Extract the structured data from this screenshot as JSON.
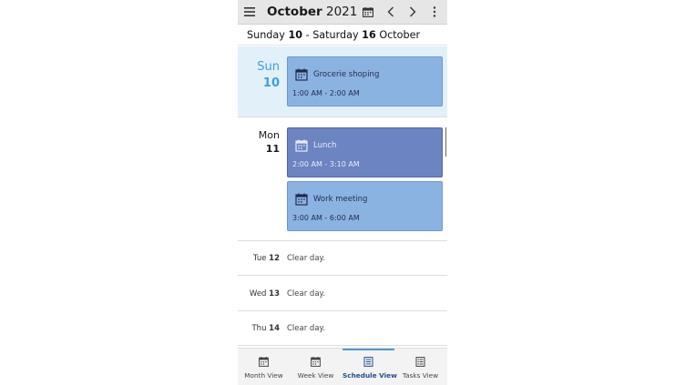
{
  "header": {
    "title_bold": "October",
    "title_year": "2021",
    "icons": [
      "menu-icon",
      "calendar-icon",
      "chevron-left-icon",
      "chevron-right-icon",
      "more-vertical-icon"
    ]
  },
  "range": {
    "start_day": "Sunday",
    "start_num": "10",
    "separator": "-",
    "end_day": "Saturday",
    "end_num": "16",
    "month": "October"
  },
  "days": [
    {
      "name": "Sun",
      "num": "10",
      "events": [
        {
          "title": "Grocerie shoping",
          "time": "1:00 AM - 2:00 AM"
        }
      ]
    },
    {
      "name": "Mon",
      "num": "11",
      "events": [
        {
          "title": "Lunch",
          "time": "2:00 AM - 3:10 AM"
        },
        {
          "title": "Work meeting",
          "time": "3:00 AM - 6:00 AM"
        }
      ]
    }
  ],
  "clear_days": [
    {
      "name": "Tue",
      "num": "12",
      "text": "Clear day."
    },
    {
      "name": "Wed",
      "num": "13",
      "text": "Clear day."
    },
    {
      "name": "Thu",
      "num": "14",
      "text": "Clear day."
    }
  ],
  "nav": [
    {
      "label": "Month View",
      "icon": "calendar-icon",
      "active": false
    },
    {
      "label": "Week View",
      "icon": "calendar-icon",
      "active": false
    },
    {
      "label": "Schedule View",
      "icon": "list-icon",
      "active": true
    },
    {
      "label": "Tasks View",
      "icon": "tasks-icon",
      "active": false
    }
  ],
  "colors": {
    "accent": "#3a9fe0",
    "event_light": "#8bb3e2",
    "event_dark": "#6c84c1",
    "selected_day_bg": "#e2f0fa"
  }
}
